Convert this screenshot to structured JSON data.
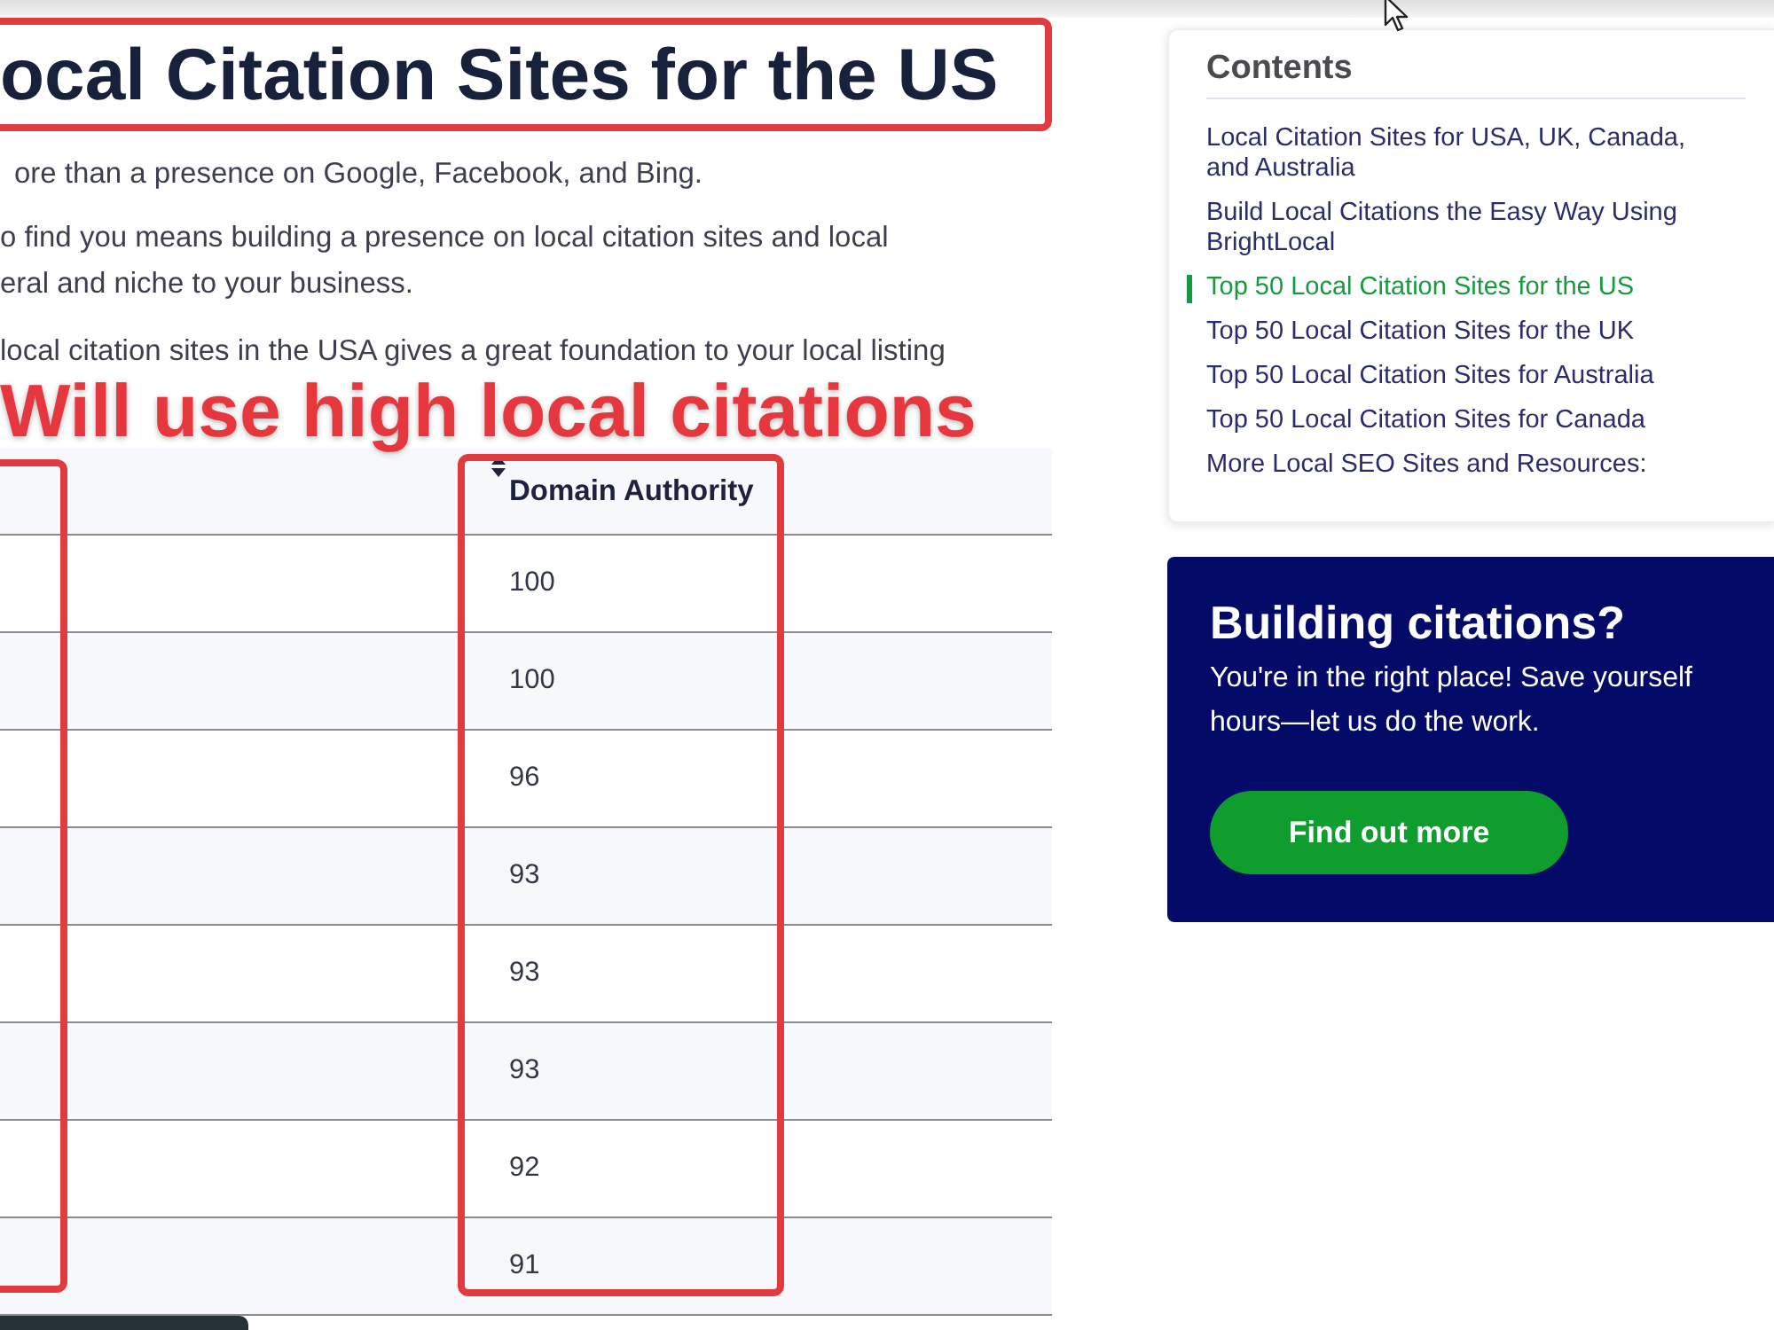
{
  "heading": "ocal Citation Sites for the US",
  "paragraphs": [
    {
      "lines": [
        "ore than a presence on Google, Facebook, and Bing."
      ]
    },
    {
      "lines": [
        "o find you means building a presence on local citation sites and local",
        "eral and niche to your business."
      ]
    },
    {
      "lines": [
        "local citation sites in the USA gives a great foundation to your local listing"
      ]
    }
  ],
  "caption": "Will use high local citations",
  "table": {
    "columns": [
      {
        "label": "Domain Authority",
        "sortable": true
      }
    ],
    "rows": [
      [
        "100"
      ],
      [
        "100"
      ],
      [
        "96"
      ],
      [
        "93"
      ],
      [
        "93"
      ],
      [
        "93"
      ],
      [
        "92"
      ],
      [
        "91"
      ]
    ]
  },
  "contents": {
    "title": "Contents",
    "items": [
      {
        "label": "Local Citation Sites for USA, UK, Canada, and Australia",
        "selected": false
      },
      {
        "label": "Build Local Citations the Easy Way Using BrightLocal",
        "selected": false
      },
      {
        "label": "Top 50 Local Citation Sites for the US",
        "selected": true
      },
      {
        "label": "Top 50 Local Citation Sites for the UK",
        "selected": false
      },
      {
        "label": "Top 50 Local Citation Sites for Australia",
        "selected": false
      },
      {
        "label": "Top 50 Local Citation Sites for Canada",
        "selected": false
      },
      {
        "label": "More Local SEO Sites and Resources:",
        "selected": false
      }
    ]
  },
  "cta": {
    "title": "Building citations?",
    "text": "You're in the right place! Save yourself hours—let us do the work.",
    "button": "Find out more"
  }
}
